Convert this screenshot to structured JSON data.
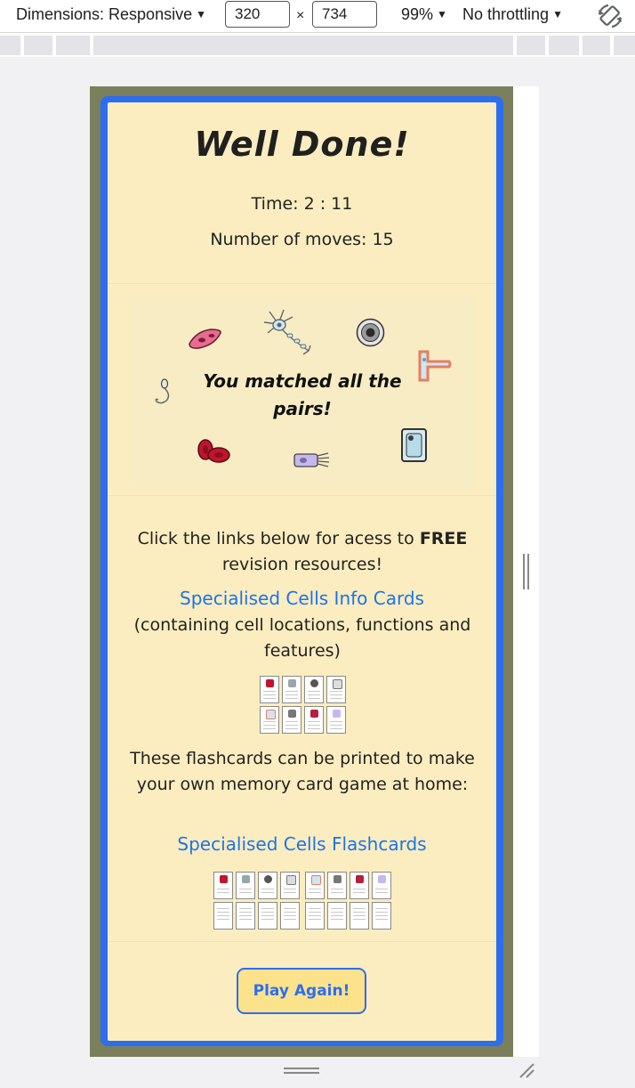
{
  "devtools": {
    "dimensions_label": "Dimensions: Responsive",
    "width_value": "320",
    "times": "×",
    "height_value": "734",
    "zoom": "99%",
    "throttling": "No throttling",
    "rotate_icon": "rotate-icon"
  },
  "game": {
    "title": "Well Done!",
    "time": "Time: 2 : 11",
    "moves": "Number of moves: 15",
    "matched_text": "You matched all the pairs!",
    "resources_intro": "Click the links below for acess to",
    "resources_free": "FREE",
    "resources_tail": "revision resources!",
    "info_cards_link": "Specialised Cells Info Cards",
    "info_cards_note": "(containing cell locations, functions and features)",
    "flashcards_text": "These flashcards can be printed to make your own memory card game at home:",
    "flashcards_link": "Specialised Cells Flashcards",
    "play_again": "Play Again!"
  },
  "colors": {
    "card_bg": "#fbedc0",
    "frame_blue": "#2c6ef0",
    "viewport_bg": "#7b7f5c",
    "link": "#1b74e8",
    "button_bg": "#fde28c"
  }
}
